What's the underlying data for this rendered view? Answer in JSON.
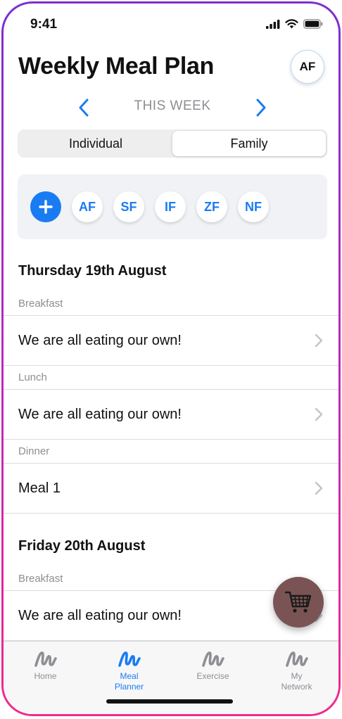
{
  "status_bar": {
    "time": "9:41"
  },
  "header": {
    "title": "Weekly Meal Plan",
    "avatar_initials": "AF"
  },
  "week_nav": {
    "label": "THIS WEEK"
  },
  "segmented": {
    "options": [
      "Individual",
      "Family"
    ],
    "selected": "Family"
  },
  "members": [
    "AF",
    "SF",
    "IF",
    "ZF",
    "NF"
  ],
  "days": [
    {
      "heading": "Thursday 19th August",
      "meals": [
        {
          "type": "Breakfast",
          "value": "We are all eating our own!"
        },
        {
          "type": "Lunch",
          "value": "We are all eating our own!"
        },
        {
          "type": "Dinner",
          "value": "Meal 1"
        }
      ]
    },
    {
      "heading": "Friday 20th August",
      "meals": [
        {
          "type": "Breakfast",
          "value": "We are all eating our own!"
        }
      ]
    }
  ],
  "tab_bar": {
    "tabs": [
      {
        "label": "Home",
        "active": false
      },
      {
        "label": "Meal Planner",
        "active": true
      },
      {
        "label": "Exercise",
        "active": false
      },
      {
        "label": "My Network",
        "active": false
      }
    ]
  },
  "colors": {
    "accent": "#1a7cf2",
    "cart_button": "#7a5454",
    "frame_gradient_top": "#7b2fd0",
    "frame_gradient_bottom": "#f02a8c"
  },
  "icons": {
    "status": [
      "cellular-signal-icon",
      "wifi-icon",
      "battery-icon"
    ],
    "week_prev": "chevron-left-icon",
    "week_next": "chevron-right-icon",
    "add_member": "plus-icon",
    "row_disclosure": "chevron-right-icon",
    "cart": "shopping-cart-icon",
    "tabs": "squiggle-logo-icon"
  }
}
